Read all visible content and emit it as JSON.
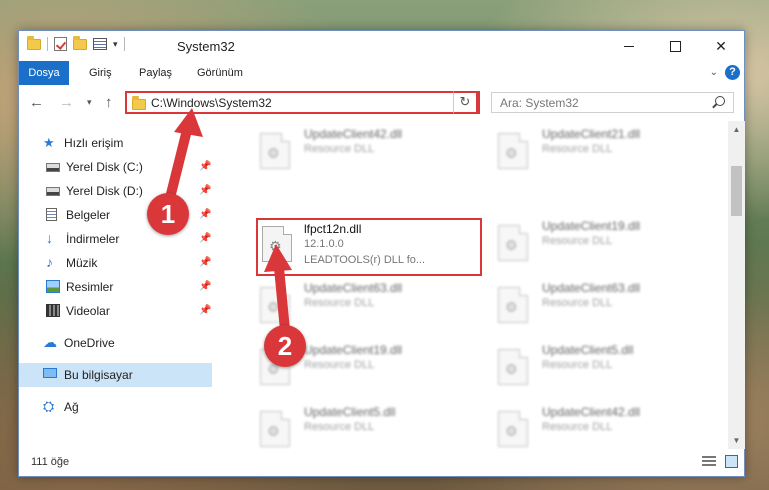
{
  "window": {
    "title": "System32",
    "controls": {
      "minimize": "—",
      "maximize": "☐",
      "close": "✕"
    }
  },
  "ribbon": {
    "tabs": [
      "Dosya",
      "Giriş",
      "Paylaş",
      "Görünüm"
    ],
    "help_label": "?"
  },
  "navigation": {
    "address": "C:\\Windows\\System32",
    "search_placeholder": "Ara: System32"
  },
  "sidebar": {
    "quick_access": "Hızlı erişim",
    "items": [
      {
        "label": "Yerel Disk (C:)",
        "icon": "drive-icon"
      },
      {
        "label": "Yerel Disk (D:)",
        "icon": "drive-icon"
      },
      {
        "label": "Belgeler",
        "icon": "documents-icon"
      },
      {
        "label": "İndirmeler",
        "icon": "downloads-icon"
      },
      {
        "label": "Müzik",
        "icon": "music-icon"
      },
      {
        "label": "Resimler",
        "icon": "pictures-icon"
      },
      {
        "label": "Videolar",
        "icon": "videos-icon"
      }
    ],
    "onedrive": "OneDrive",
    "this_pc": "Bu bilgisayar",
    "network": "Ağ"
  },
  "files": {
    "main": {
      "name": "lfpct12n.dll",
      "version": "12.1.0.0",
      "description": "LEADTOOLS(r) DLL fo..."
    },
    "left_column": [
      {
        "name": "UpdateClient42.dll",
        "type": "Resource DLL"
      },
      {
        "name": "UpdateClient63.dll",
        "type": "Resource DLL"
      },
      {
        "name": "UpdateClient19.dll",
        "type": "Resource DLL"
      },
      {
        "name": "UpdateClient5.dll",
        "type": "Resource DLL"
      }
    ],
    "right_column": [
      {
        "name": "UpdateClient21.dll",
        "type": "Resource DLL"
      },
      {
        "name": "UpdateClient19.dll",
        "type": "Resource DLL"
      },
      {
        "name": "UpdateClient63.dll",
        "type": "Resource DLL"
      },
      {
        "name": "UpdateClient5.dll",
        "type": "Resource DLL"
      },
      {
        "name": "UpdateClient42.dll",
        "type": "Resource DLL"
      }
    ]
  },
  "status": {
    "item_count": "111 öğe"
  },
  "annotations": {
    "step1": "1",
    "step2": "2",
    "color": "#d9373a"
  }
}
